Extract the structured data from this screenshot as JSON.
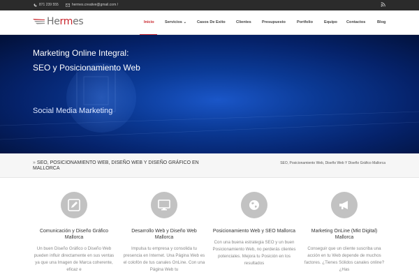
{
  "topbar": {
    "phone": "871 239 555",
    "email": "hermes.creative@gmail.com /",
    "icons": [
      "phone-icon",
      "mail-icon",
      "rss-icon"
    ]
  },
  "logo": {
    "text_gray": "He",
    "text_red": "rm",
    "text_gray2": "es"
  },
  "nav": {
    "items": [
      "Inicio",
      "Servicios",
      "Casos De Exito",
      "Clientes",
      "Presupuesto",
      "Portfolio",
      "Equipo",
      "Contactos",
      "Blog"
    ],
    "dropdown_caret": "⌄",
    "active": "Inicio",
    "accent_color": "#c8242b"
  },
  "hero": {
    "line1": "Marketing Online Integral:",
    "line2": "SEO y Posicionamiento Web",
    "line3": "Social Media Marketing"
  },
  "breadcrumb": {
    "chevron": "»",
    "title": "SEO, POSICIONAMIENTO WEB, DISEÑO WEB Y DISEÑO GRÁFICO EN MALLORCA",
    "trail": "SEO, Posicionamiento Web, Diseño Web Y Diseño Gráfico Mallorca"
  },
  "features": [
    {
      "icon": "pencil-icon",
      "title": "Comunicación y Diseño Gráfico Mallorca",
      "desc": "Un buen Diseño Gráfico o Diseño Web pueden influir directamente en sus ventas ya que una Imagen de Marca coherente, eficaz e"
    },
    {
      "icon": "monitor-icon",
      "title": "Desarrollo Web y Diseño Web Mallorca",
      "desc": "Impulsa tu empresa y consolida tu presencia en Internet. Una Página Web es el colofón de tus canales OnLine. Con una Página Web tu"
    },
    {
      "icon": "globe-icon",
      "title": "Posicionamiento Web y SEO Mallorca",
      "desc": "Con una buena estrategia SEO y un buen Posicionamiento Web, no perderás clientes potenciales. Mejora tu Posición en los resultados"
    },
    {
      "icon": "megaphone-icon",
      "title": "Marketing OnLine (Mkt Digital) Mallorca",
      "desc": "Conseguir que un cliente suscriba una acción en tu Web depende de muchos factores. ¿Tienes Sólidos canales online? ¿Has"
    }
  ]
}
